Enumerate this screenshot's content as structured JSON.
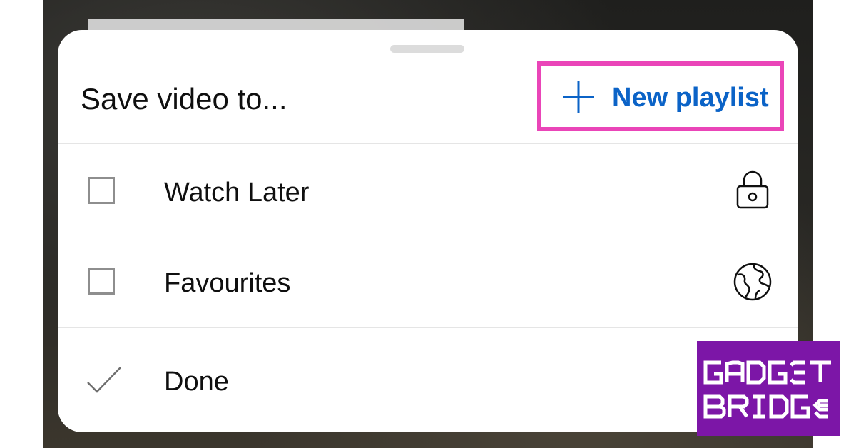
{
  "sheet": {
    "title": "Save video to...",
    "new_playlist": {
      "label": "New playlist",
      "icon": "plus-icon",
      "color": "#0b63c7",
      "highlight_color": "#ea45b8"
    }
  },
  "playlists": [
    {
      "label": "Watch Later",
      "checked": false,
      "privacy_icon": "lock-icon"
    },
    {
      "label": "Favourites",
      "checked": false,
      "privacy_icon": "globe-icon"
    }
  ],
  "done": {
    "label": "Done",
    "icon": "check-icon"
  },
  "watermark": {
    "line1": "GADGET",
    "line2": "BRIDGE",
    "background": "#7c16a7"
  }
}
